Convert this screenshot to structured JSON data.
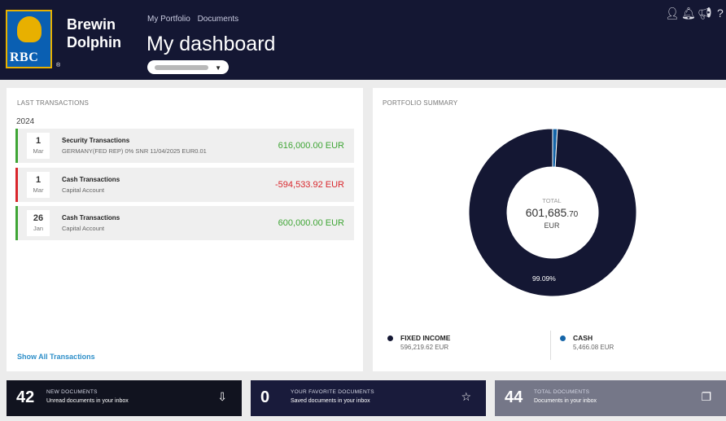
{
  "header": {
    "brand_line1": "Brewin",
    "brand_line2": "Dolphin",
    "logo_text": "RBC",
    "nav": [
      "My Portfolio",
      "Documents"
    ],
    "title": "My dashboard",
    "icons": [
      "user-icon",
      "bell-icon",
      "megaphone-icon",
      "help-icon"
    ]
  },
  "transactions": {
    "title": "LAST TRANSACTIONS",
    "year": "2024",
    "items": [
      {
        "day": "1",
        "month": "Mar",
        "type": "Security Transactions",
        "desc": "GERMANY(FED REP) 0% SNR 11/04/2025 EUR0.01",
        "amount": "616,000.00 EUR",
        "color": "#3fa535"
      },
      {
        "day": "1",
        "month": "Mar",
        "type": "Cash Transactions",
        "desc": "Capital Account",
        "amount": "-594,533.92 EUR",
        "color": "#d9262c"
      },
      {
        "day": "26",
        "month": "Jan",
        "type": "Cash Transactions",
        "desc": "Capital Account",
        "amount": "600,000.00 EUR",
        "color": "#3fa535"
      }
    ],
    "show_all": "Show All Transactions"
  },
  "summary": {
    "title": "PORTFOLIO SUMMARY",
    "total_label": "TOTAL",
    "total_value": "601,685",
    "total_decimal": ".70",
    "currency": "EUR",
    "main_pct": "99.09%",
    "legend": [
      {
        "name": "FIXED INCOME",
        "value": "596,219.62 EUR",
        "color": "#141733"
      },
      {
        "name": "CASH",
        "value": "5,466.08 EUR",
        "color": "#1565a8"
      }
    ]
  },
  "chart_data": {
    "type": "pie",
    "categories": [
      "FIXED INCOME",
      "CASH"
    ],
    "values": [
      596219.62,
      5466.08
    ],
    "title": "PORTFOLIO SUMMARY"
  },
  "cards": [
    {
      "count": "42",
      "title": "NEW DOCUMENTS",
      "subtitle": "Unread documents in your inbox",
      "icon": "inbox-download-icon"
    },
    {
      "count": "0",
      "title": "YOUR FAVORITE DOCUMENTS",
      "subtitle": "Saved documents in your inbox",
      "icon": "star-icon"
    },
    {
      "count": "44",
      "title": "TOTAL DOCUMENTS",
      "subtitle": "Documents in your inbox",
      "icon": "documents-icon"
    }
  ]
}
